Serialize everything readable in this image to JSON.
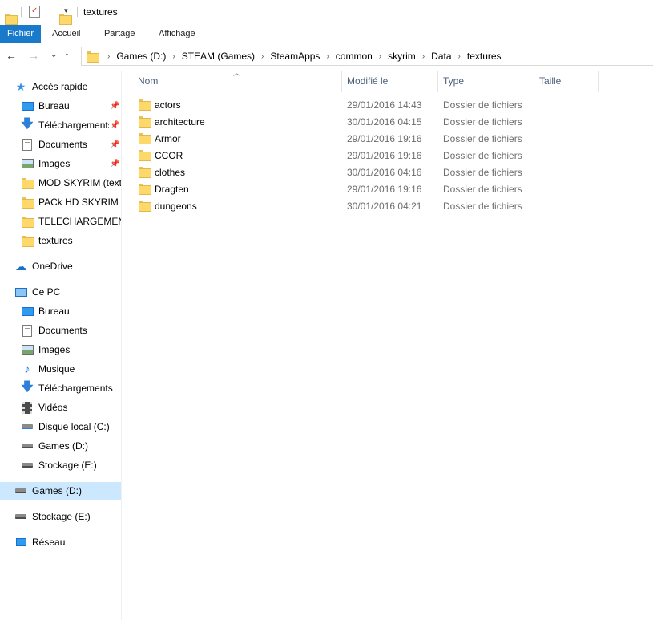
{
  "window": {
    "title": "textures"
  },
  "ribbon": {
    "tabs": [
      {
        "label": "Fichier"
      },
      {
        "label": "Accueil"
      },
      {
        "label": "Partage"
      },
      {
        "label": "Affichage"
      }
    ]
  },
  "address": {
    "crumbs": [
      "Games (D:)",
      "STEAM (Games)",
      "SteamApps",
      "common",
      "skyrim",
      "Data",
      "textures"
    ]
  },
  "nav": {
    "quick_access": {
      "label": "Accès rapide",
      "icon": "star-icon"
    },
    "quick_items": [
      {
        "label": "Bureau",
        "icon": "desktop-icon",
        "pinned": true
      },
      {
        "label": "Téléchargements",
        "icon": "download-arrow-icon",
        "pinned": true
      },
      {
        "label": "Documents",
        "icon": "document-icon",
        "pinned": true
      },
      {
        "label": "Images",
        "icon": "pictures-icon",
        "pinned": true
      },
      {
        "label": "MOD SKYRIM (textu",
        "icon": "folder-icon",
        "pinned": false
      },
      {
        "label": "PACk HD SKYRIM C",
        "icon": "folder-icon",
        "pinned": false
      },
      {
        "label": "TELECHARGEMENT",
        "icon": "folder-icon",
        "pinned": false
      },
      {
        "label": "textures",
        "icon": "folder-icon",
        "pinned": false
      }
    ],
    "onedrive": {
      "label": "OneDrive",
      "icon": "cloud-icon"
    },
    "this_pc": {
      "label": "Ce PC",
      "icon": "computer-icon"
    },
    "pc_items": [
      {
        "label": "Bureau",
        "icon": "desktop-icon"
      },
      {
        "label": "Documents",
        "icon": "document-icon"
      },
      {
        "label": "Images",
        "icon": "pictures-icon"
      },
      {
        "label": "Musique",
        "icon": "music-note-icon"
      },
      {
        "label": "Téléchargements",
        "icon": "download-arrow-icon"
      },
      {
        "label": "Vidéos",
        "icon": "video-icon"
      },
      {
        "label": "Disque local (C:)",
        "icon": "system-drive-icon"
      },
      {
        "label": "Games (D:)",
        "icon": "drive-icon"
      },
      {
        "label": "Stockage (E:)",
        "icon": "drive-icon"
      }
    ],
    "games_drive": {
      "label": "Games (D:)",
      "icon": "drive-icon",
      "selected": true
    },
    "storage_drive": {
      "label": "Stockage (E:)",
      "icon": "drive-icon"
    },
    "network": {
      "label": "Réseau",
      "icon": "network-icon"
    }
  },
  "columns": {
    "name": "Nom",
    "modified": "Modifié le",
    "type": "Type",
    "size": "Taille"
  },
  "files": [
    {
      "name": "actors",
      "modified": "29/01/2016 14:43",
      "type": "Dossier de fichiers",
      "size": ""
    },
    {
      "name": "architecture",
      "modified": "30/01/2016 04:15",
      "type": "Dossier de fichiers",
      "size": ""
    },
    {
      "name": "Armor",
      "modified": "29/01/2016 19:16",
      "type": "Dossier de fichiers",
      "size": ""
    },
    {
      "name": "CCOR",
      "modified": "29/01/2016 19:16",
      "type": "Dossier de fichiers",
      "size": ""
    },
    {
      "name": "clothes",
      "modified": "30/01/2016 04:16",
      "type": "Dossier de fichiers",
      "size": ""
    },
    {
      "name": "Dragten",
      "modified": "29/01/2016 19:16",
      "type": "Dossier de fichiers",
      "size": ""
    },
    {
      "name": "dungeons",
      "modified": "30/01/2016 04:21",
      "type": "Dossier de fichiers",
      "size": ""
    }
  ],
  "colors": {
    "accent": "#1979ca",
    "header_text": "#4c607a",
    "secondary_text": "#6d6d6d",
    "selected_bg": "#cce8ff",
    "folder": "#ffd86a"
  }
}
